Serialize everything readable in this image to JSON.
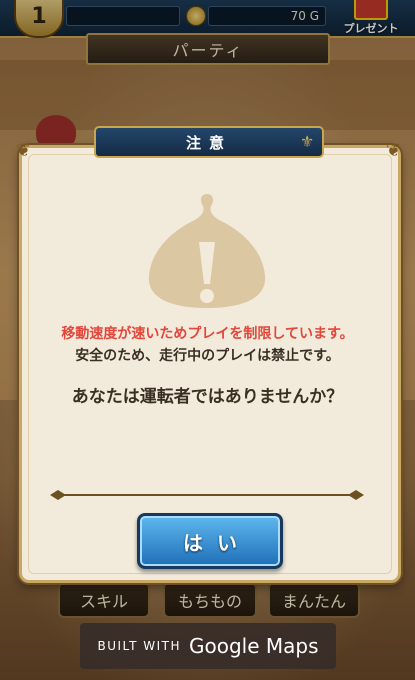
{
  "topbar": {
    "level": "1",
    "gold": "70 G",
    "gift_label": "プレゼント"
  },
  "screen": {
    "title": "パーティ"
  },
  "bottom_menu": {
    "items": [
      "スキル",
      "もちもの",
      "まんたん"
    ]
  },
  "dialog": {
    "title": "注意",
    "warning_red": "移動速度が速いためプレイを制限しています。",
    "warning_text": "安全のため、走行中のプレイは禁止です。",
    "question": "あなたは運転者ではありませんか？",
    "yes_label": "はい",
    "icon": "slime-exclamation-icon",
    "colors": {
      "accent_red": "#e3473b",
      "button_blue": "#1f6fb8",
      "panel": "#f2eadb",
      "gold_trim": "#c9a865"
    }
  },
  "maps_badge": {
    "prefix": "BUILT WITH",
    "brand": "Google Maps"
  }
}
